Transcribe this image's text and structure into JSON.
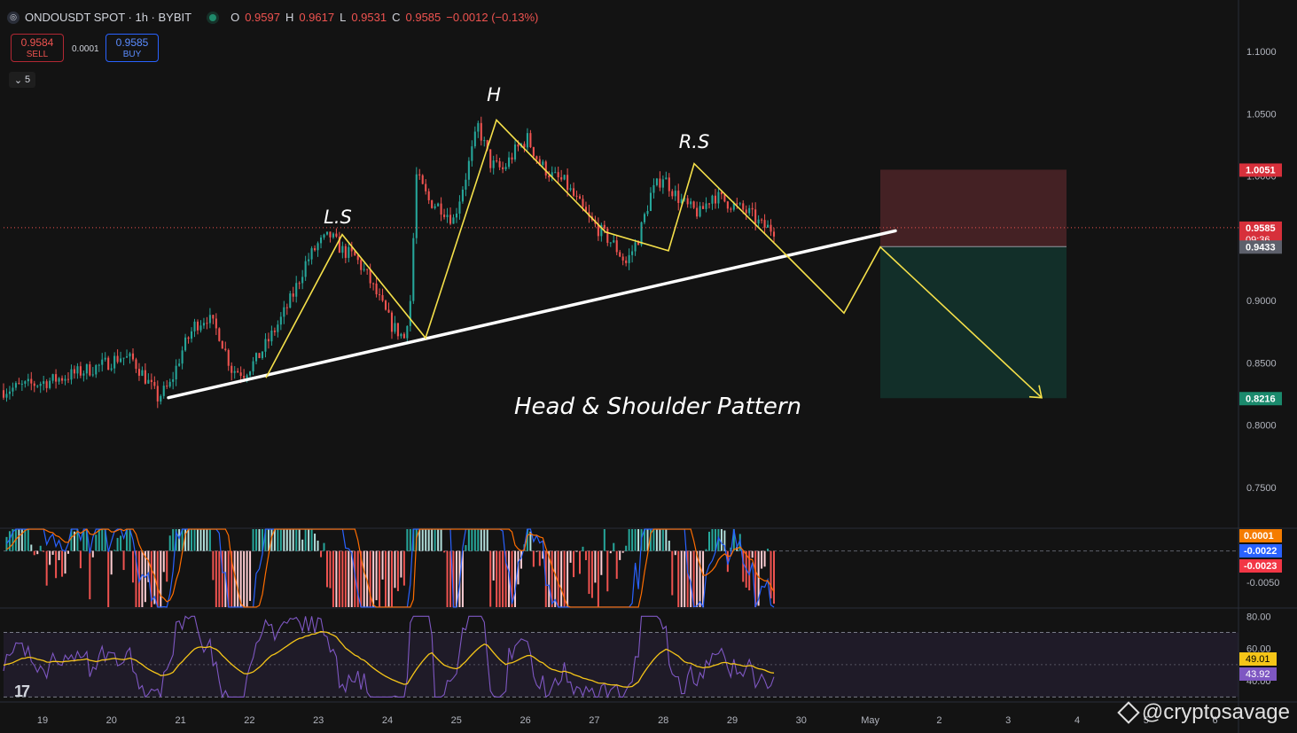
{
  "header": {
    "symbol": "ONDOUSDT SPOT · 1h · BYBIT",
    "o_label": "O",
    "o_value": "0.9597",
    "h_label": "H",
    "h_value": "0.9617",
    "l_label": "L",
    "l_value": "0.9531",
    "c_label": "C",
    "c_value": "0.9585",
    "change": "−0.0012 (−0.13%)"
  },
  "trade": {
    "sell_price": "0.9584",
    "sell_label": "SELL",
    "spread": "0.0001",
    "buy_price": "0.9585",
    "buy_label": "BUY",
    "collapse_count": "5"
  },
  "watermark": "@cryptosavage",
  "colors": {
    "background": "#131313",
    "up": "#26a69a",
    "down": "#ef5350",
    "pattern": "#f5e04a",
    "trendline": "#ffffff",
    "stop_zone": "#4a2327",
    "target_zone": "#12302a",
    "macd_line": "#2962ff",
    "signal_line": "#ff6d00",
    "rsi_line": "#7e57c2",
    "rsi_ma": "#f5c518"
  },
  "chart_data": [
    {
      "type": "candlestick",
      "name": "price",
      "x_labels": [
        "19",
        "20",
        "21",
        "22",
        "23",
        "24",
        "25",
        "26",
        "27",
        "28",
        "29",
        "30",
        "May",
        "2",
        "3",
        "4",
        "5",
        "6"
      ],
      "y_ticks": [
        "1.1000",
        "1.0500",
        "1.0000",
        "0.9500",
        "0.9000",
        "0.8500",
        "0.8000",
        "0.7500"
      ],
      "ylim": [
        0.72,
        1.12
      ],
      "price_path": [
        [
          0,
          0.828
        ],
        [
          4,
          0.832
        ],
        [
          8,
          0.836
        ],
        [
          12,
          0.842
        ],
        [
          16,
          0.848
        ],
        [
          19,
          0.855
        ],
        [
          21,
          0.852
        ],
        [
          23,
          0.838
        ],
        [
          25,
          0.822
        ],
        [
          27,
          0.832
        ],
        [
          29,
          0.86
        ],
        [
          31,
          0.88
        ],
        [
          33,
          0.887
        ],
        [
          35,
          0.873
        ],
        [
          37,
          0.845
        ],
        [
          39,
          0.842
        ],
        [
          41,
          0.852
        ],
        [
          43,
          0.868
        ],
        [
          45,
          0.885
        ],
        [
          47,
          0.905
        ],
        [
          49,
          0.93
        ],
        [
          51,
          0.945
        ],
        [
          53,
          0.952
        ],
        [
          55,
          0.94
        ],
        [
          57,
          0.935
        ],
        [
          59,
          0.92
        ],
        [
          61,
          0.9
        ],
        [
          63,
          0.88
        ],
        [
          65,
          0.87
        ],
        [
          66,
          0.9
        ],
        [
          67,
          1.0
        ],
        [
          69,
          0.98
        ],
        [
          71,
          0.975
        ],
        [
          73,
          0.965
        ],
        [
          75,
          1.0
        ],
        [
          77,
          1.04
        ],
        [
          79,
          1.01
        ],
        [
          81,
          1.005
        ],
        [
          83,
          1.02
        ],
        [
          85,
          1.03
        ],
        [
          87,
          1.01
        ],
        [
          89,
          1.0
        ],
        [
          91,
          0.995
        ],
        [
          93,
          0.98
        ],
        [
          95,
          0.965
        ],
        [
          97,
          0.955
        ],
        [
          99,
          0.945
        ],
        [
          101,
          0.93
        ],
        [
          103,
          0.95
        ],
        [
          105,
          0.985
        ],
        [
          107,
          1.0
        ],
        [
          109,
          0.985
        ],
        [
          111,
          0.975
        ],
        [
          113,
          0.97
        ],
        [
          115,
          0.985
        ],
        [
          117,
          0.98
        ],
        [
          119,
          0.975
        ],
        [
          121,
          0.97
        ],
        [
          123,
          0.96
        ],
        [
          125,
          0.957
        ]
      ],
      "last_price": "0.9585",
      "countdown": "09:36",
      "entry_level": "0.9433",
      "stop_level": "1.0051",
      "target_level": "0.8216",
      "annotations": [
        "L.S",
        "H",
        "R.S",
        "Head & Shoulder Pattern"
      ],
      "pattern_path_points": [
        [
          0.9,
          0.822
        ],
        [
          2.3,
          0.838
        ],
        [
          3.4,
          0.953
        ],
        [
          4.67,
          0.87
        ],
        [
          5.7,
          1.045
        ],
        [
          7.35,
          0.955
        ],
        [
          8.7,
          1.01
        ],
        [
          9.5,
          0.94
        ],
        [
          10.35,
          0.89
        ],
        [
          10.9,
          0.943
        ],
        [
          12.8,
          0.822
        ]
      ],
      "neckline": [
        [
          2.0,
          0.822
        ],
        [
          8.3,
          0.956
        ]
      ]
    },
    {
      "type": "macd",
      "name": "MACD",
      "y_ticks": [
        "-0.0050"
      ],
      "ylim": [
        -0.009,
        0.0035
      ],
      "histogram_value": "0.0001",
      "macd_value": "-0.0022",
      "signal_value": "-0.0023"
    },
    {
      "type": "line",
      "name": "RSI",
      "y_ticks": [
        "80.00",
        "60.00",
        "40.00"
      ],
      "ylim": [
        28,
        84
      ],
      "band": [
        30,
        70
      ],
      "midline": 50,
      "ma_value": "49.01",
      "rsi_value": "43.92"
    }
  ]
}
